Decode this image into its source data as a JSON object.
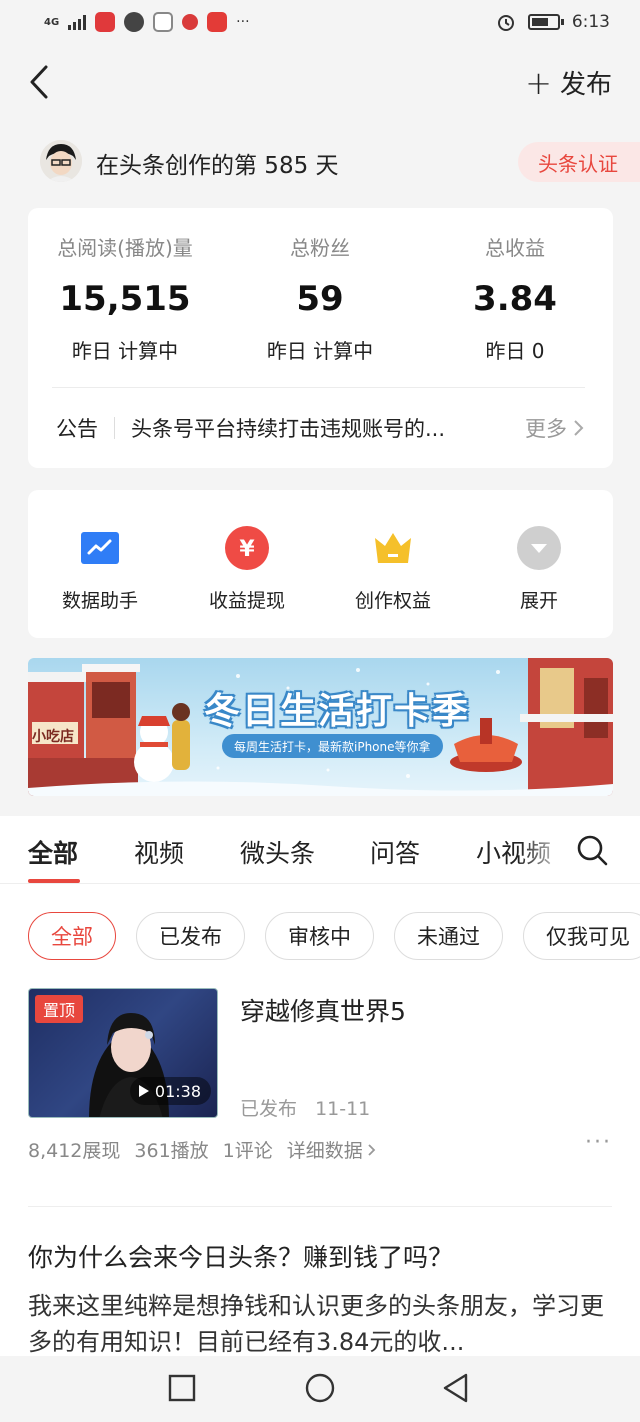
{
  "status_bar": {
    "network": "4G",
    "time": "6:13",
    "more": "···"
  },
  "header": {
    "publish_label": "发布"
  },
  "creator": {
    "days_text": "在头条创作的第 585 天",
    "cert_label": "头条认证"
  },
  "stats": [
    {
      "label": "总阅读(播放)量",
      "value": "15,515",
      "sub": "昨日 计算中"
    },
    {
      "label": "总粉丝",
      "value": "59",
      "sub": "昨日 计算中"
    },
    {
      "label": "总收益",
      "value": "3.84",
      "sub": "昨日 0"
    }
  ],
  "announcement": {
    "label": "公告",
    "text": "头条号平台持续打击违规账号的...",
    "more": "更多"
  },
  "tools": [
    {
      "label": "数据助手",
      "icon": "chart-trend-icon",
      "color": "#2f7df6"
    },
    {
      "label": "收益提现",
      "icon": "yuan-icon",
      "color": "#ef4b45"
    },
    {
      "label": "创作权益",
      "icon": "crown-icon",
      "color": "#f5c02a"
    },
    {
      "label": "展开",
      "icon": "expand-icon",
      "color": "#c9c9c9"
    }
  ],
  "banner": {
    "title": "冬日生活打卡季",
    "subtitle": "每周生活打卡，最新款iPhone等你拿",
    "shop_sign": "小吃店"
  },
  "tabs": [
    "全部",
    "视频",
    "微头条",
    "问答",
    "小视频"
  ],
  "filters": [
    "全部",
    "已发布",
    "审核中",
    "未通过",
    "仅我可见"
  ],
  "article": {
    "pin_label": "置顶",
    "duration": "01:38",
    "title": "穿越修真世界5",
    "status": "已发布",
    "date": "11-11",
    "impressions": "8,412展现",
    "plays": "361播放",
    "comments": "1评论",
    "details": "详细数据",
    "more": "···"
  },
  "post": {
    "title": "你为什么会来今日头条？赚到钱了吗？",
    "body": "我来这里纯粹是想挣钱和认识更多的头条朋友，学习更多的有用知识！目前已经有3.84元的收..."
  },
  "colors": {
    "accent": "#e8473e",
    "background": "#f4f4f4",
    "card": "#ffffff"
  }
}
